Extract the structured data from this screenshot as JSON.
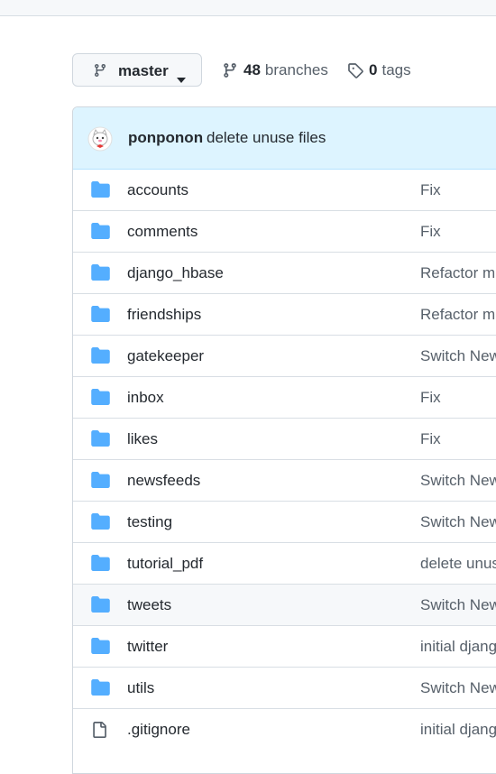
{
  "branch_selector": {
    "label": "master"
  },
  "branches": {
    "count": "48",
    "label": "branches"
  },
  "tags": {
    "count": "0",
    "label": "tags"
  },
  "latest_commit": {
    "author": "ponponon",
    "message": "delete unuse files"
  },
  "files": [
    {
      "name": "accounts",
      "type": "folder",
      "commit": "Fix"
    },
    {
      "name": "comments",
      "type": "folder",
      "commit": "Fix"
    },
    {
      "name": "django_hbase",
      "type": "folder",
      "commit": "Refactor m"
    },
    {
      "name": "friendships",
      "type": "folder",
      "commit": "Refactor m"
    },
    {
      "name": "gatekeeper",
      "type": "folder",
      "commit": "Switch New"
    },
    {
      "name": "inbox",
      "type": "folder",
      "commit": "Fix"
    },
    {
      "name": "likes",
      "type": "folder",
      "commit": "Fix"
    },
    {
      "name": "newsfeeds",
      "type": "folder",
      "commit": "Switch New"
    },
    {
      "name": "testing",
      "type": "folder",
      "commit": "Switch New"
    },
    {
      "name": "tutorial_pdf",
      "type": "folder",
      "commit": "delete unus"
    },
    {
      "name": "tweets",
      "type": "folder",
      "commit": "Switch New"
    },
    {
      "name": "twitter",
      "type": "folder",
      "commit": "initial djang"
    },
    {
      "name": "utils",
      "type": "folder",
      "commit": "Switch New"
    },
    {
      "name": ".gitignore",
      "type": "file",
      "commit": "initial djang"
    }
  ],
  "colors": {
    "folder": "#54aeff",
    "commit_bar": "#ddf4ff",
    "muted": "#57606a"
  },
  "icons": {
    "branch": "git-branch-icon",
    "tag": "tag-icon",
    "caret": "caret-down-icon",
    "folder": "folder-icon",
    "file": "file-icon"
  }
}
